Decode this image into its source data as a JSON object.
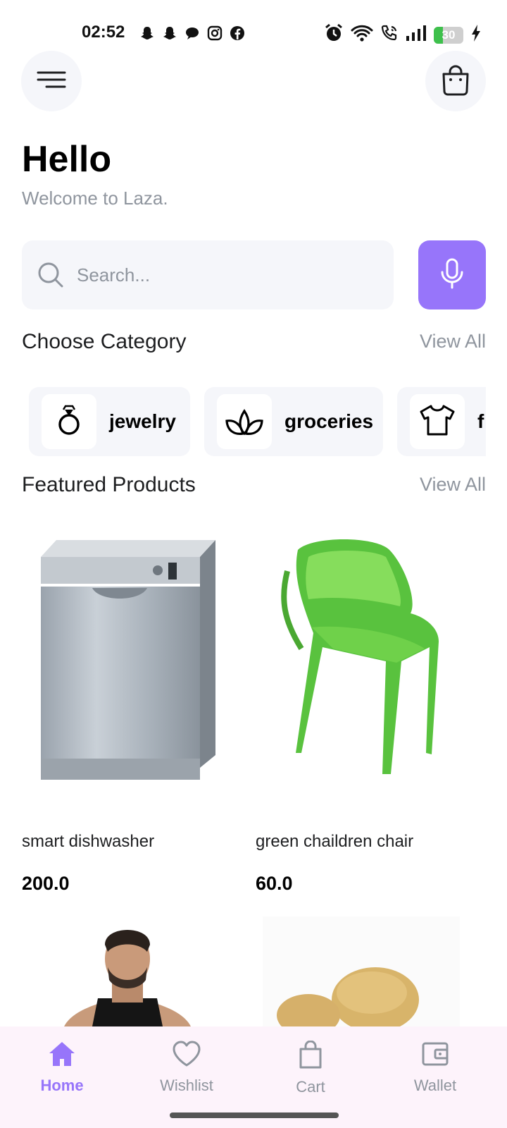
{
  "status_bar": {
    "time": "02:52",
    "battery_level": "30",
    "notification_icons": [
      "snapchat-icon",
      "snapchat-icon",
      "chat-bubble-icon",
      "instagram-icon",
      "facebook-icon"
    ],
    "system_icons": [
      "alarm-icon",
      "wifi-icon",
      "wifi-call-icon",
      "signal-icon",
      "battery-icon",
      "charging-icon"
    ]
  },
  "header": {
    "menu_icon": "menu-icon",
    "bag_icon": "shopping-bag-icon",
    "greeting": "Hello",
    "subtitle": "Welcome to Laza."
  },
  "search": {
    "placeholder": "Search...",
    "value": "",
    "mic_icon": "microphone-icon"
  },
  "categories": {
    "title": "Choose Category",
    "view_all": "View All",
    "items": [
      {
        "label": "jewelry",
        "icon": "ring-icon"
      },
      {
        "label": "groceries",
        "icon": "leaf-icon"
      },
      {
        "label": "f",
        "icon": "tshirt-icon"
      }
    ]
  },
  "featured": {
    "title": "Featured Products",
    "view_all": "View All",
    "products": [
      {
        "name": "smart dishwasher",
        "price": "200.0"
      },
      {
        "name": "green chaildren chair",
        "price": "60.0"
      }
    ]
  },
  "bottom_nav": {
    "items": [
      {
        "label": "Home",
        "icon": "home-icon",
        "active": true
      },
      {
        "label": "Wishlist",
        "icon": "heart-icon",
        "active": false
      },
      {
        "label": "Cart",
        "icon": "shopping-bag-icon",
        "active": false
      },
      {
        "label": "Wallet",
        "icon": "wallet-icon",
        "active": false
      }
    ]
  },
  "colors": {
    "accent": "#9775fa",
    "muted_text": "#8f959e",
    "surface": "#f5f6fa",
    "nav_background": "#fdf3fb"
  }
}
